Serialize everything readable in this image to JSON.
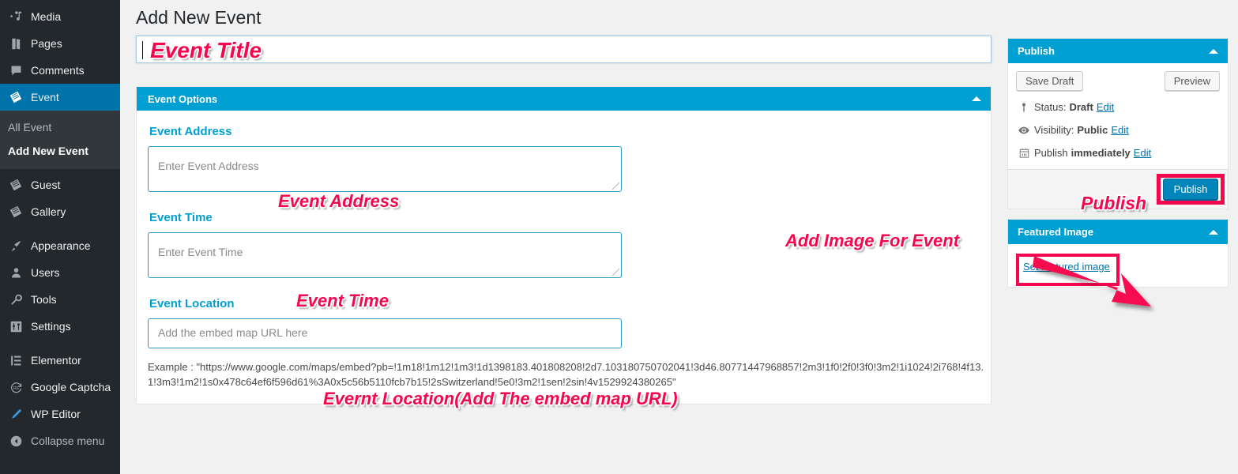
{
  "sidebar": {
    "items": [
      {
        "label": "Media",
        "icon": "media-icon",
        "current": false
      },
      {
        "label": "Pages",
        "icon": "pages-icon",
        "current": false
      },
      {
        "label": "Comments",
        "icon": "comments-icon",
        "current": false
      },
      {
        "label": "Event",
        "icon": "event-icon",
        "current": true
      },
      {
        "label": "Guest",
        "icon": "guest-icon",
        "current": false
      },
      {
        "label": "Gallery",
        "icon": "gallery-icon",
        "current": false
      },
      {
        "label": "Appearance",
        "icon": "appearance-icon",
        "current": false
      },
      {
        "label": "Users",
        "icon": "users-icon",
        "current": false
      },
      {
        "label": "Tools",
        "icon": "tools-icon",
        "current": false
      },
      {
        "label": "Settings",
        "icon": "settings-icon",
        "current": false
      },
      {
        "label": "Elementor",
        "icon": "elementor-icon",
        "current": false
      },
      {
        "label": "Google Captcha",
        "icon": "captcha-icon",
        "current": false
      },
      {
        "label": "WP Editor",
        "icon": "wp-editor-icon",
        "current": false
      },
      {
        "label": "Collapse menu",
        "icon": "collapse-icon",
        "current": false
      }
    ],
    "submenu": [
      {
        "label": "All Event",
        "current": false
      },
      {
        "label": "Add New Event",
        "current": true
      }
    ]
  },
  "header": {
    "title": "Add New Event"
  },
  "title_field": {
    "value": "",
    "placeholder": ""
  },
  "event_options": {
    "panel_title": "Event Options",
    "collapse_icon": "caret-up-icon",
    "fields": [
      {
        "label": "Event Address",
        "placeholder": "Enter Event Address"
      },
      {
        "label": "Event Time",
        "placeholder": "Enter Event Time"
      },
      {
        "label": "Event Location",
        "placeholder": "Add the embed map URL here"
      }
    ],
    "example": "Example : \"https://www.google.com/maps/embed?pb=!1m18!1m12!1m3!1d1398183.401808208!2d7.103180750702041!3d46.80771447968857!2m3!1f0!2f0!3f0!3m2!1i1024!2i768!4f13.1!3m3!1m2!1s0x478c64ef6f596d61%3A0x5c56b5110fcb7b15!2sSwitzerland!5e0!3m2!1sen!2sin!4v1529924380265\""
  },
  "publish_box": {
    "title": "Publish",
    "collapse_icon": "caret-up-icon",
    "save_draft": "Save Draft",
    "preview": "Preview",
    "status": {
      "icon": "pin-icon",
      "prefix": "Status:",
      "value": "Draft",
      "edit": "Edit"
    },
    "visibility": {
      "icon": "eye-icon",
      "prefix": "Visibility:",
      "value": "Public",
      "edit": "Edit"
    },
    "schedule": {
      "icon": "calendar-icon",
      "prefix": "Publish",
      "value": "immediately",
      "edit": "Edit"
    },
    "publish_button": "Publish"
  },
  "featured_image_box": {
    "title": "Featured Image",
    "collapse_icon": "caret-up-icon",
    "set_link": "Set featured image"
  },
  "annotations": {
    "color": "#f5074f",
    "items": [
      {
        "name": "anno-event-title",
        "text": "Event Title"
      },
      {
        "name": "anno-event-address",
        "text": "Event Address"
      },
      {
        "name": "anno-event-time",
        "text": "Event Time"
      },
      {
        "name": "anno-event-location",
        "text": "Evernt Location(Add The embed map URL)"
      },
      {
        "name": "anno-add-image",
        "text": "Add Image For Event"
      },
      {
        "name": "anno-publish",
        "text": "Publish"
      }
    ]
  },
  "colors": {
    "wp_blue": "#00a0d2",
    "wp_blue_dark": "#0073aa",
    "sidebar_bg": "#23282d",
    "submenu_bg": "#32373c",
    "annotation_pink": "#f5074f",
    "page_bg": "#f1f1f1"
  }
}
